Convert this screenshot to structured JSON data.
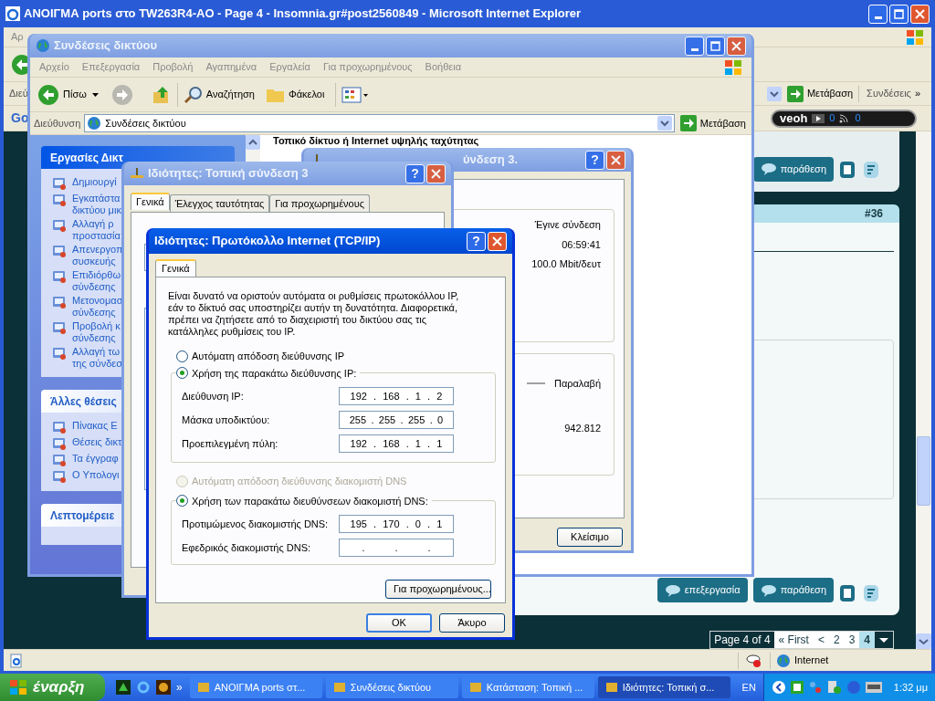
{
  "browser": {
    "title": "ΑΝΟΙΓΜΑ ports στο TW263R4-AO - Page 4 - Insomnia.gr#post2560849 - Microsoft Internet Explorer",
    "controls": [
      {
        "kind": "minimize"
      },
      {
        "kind": "maximize"
      },
      {
        "kind": "close"
      }
    ],
    "menu_fragment": "Αρ",
    "links_fragment": "Διεύ",
    "go_button": "Μετάβαση",
    "links_label": "Συνδέσεις",
    "links_chevron": "»",
    "google_fragment": "Go",
    "veoh_logo": "veoh",
    "veoh_counts": [
      "0",
      "0"
    ],
    "zone": "Internet"
  },
  "forum": {
    "quote_button_top": "παράθεση",
    "post_number": "#36",
    "edit_button": "επεξεργασία",
    "quote_button": "παράθεση",
    "page_label": "Page 4 of 4",
    "pages": [
      {
        "text": "« First",
        "selected": false
      },
      {
        "text": "<",
        "selected": false
      },
      {
        "text": "2",
        "selected": false
      },
      {
        "text": "3",
        "selected": false
      },
      {
        "text": "4",
        "selected": true
      }
    ]
  },
  "network_window": {
    "title": "Συνδέσεις δικτύου",
    "controls": [
      {
        "kind": "minimize"
      },
      {
        "kind": "maximize"
      },
      {
        "kind": "close"
      }
    ],
    "menu": [
      "Αρχείο",
      "Επεξεργασία",
      "Προβολή",
      "Αγαπημένα",
      "Εργαλεία",
      "Για προχωρημένους",
      "Βοήθεια"
    ],
    "back_button": "Πίσω",
    "search_button": "Αναζήτηση",
    "folders_button": "Φάκελοι",
    "address_label": "Διεύθυνση",
    "address": "Συνδέσεις δικτύου",
    "go_button": "Μετάβαση",
    "section_header": "Τοπικό δίκτυο ή Internet υψηλής ταχύτητας",
    "task_groups": [
      {
        "title": "Εργασίες Δικτ",
        "items": [
          [
            "Δημιουργί"
          ],
          [
            "Εγκατάστα",
            "δικτύου μικ"
          ],
          [
            "Αλλαγή ρ",
            "προστασία"
          ],
          [
            "Απενεργοπ",
            "συσκευής"
          ],
          [
            "Επιδιόρθω",
            "σύνδεσης"
          ],
          [
            "Μετονομασ",
            "σύνδεσης"
          ],
          [
            "Προβολή κ",
            "σύνδεσης"
          ],
          [
            "Αλλαγή τω",
            "της σύνδεσ"
          ]
        ]
      },
      {
        "title": "Άλλες θέσεις",
        "items": [
          [
            "Πίνακας Ε"
          ],
          [
            "Θέσεις δικτ"
          ],
          [
            "Τα έγγραφ"
          ],
          [
            "Ο Υπολογι"
          ]
        ]
      },
      {
        "title": "Λεπτομέρειε"
      }
    ]
  },
  "status_window": {
    "title": "ύνδεση 3.",
    "controls": [
      {
        "kind": "help",
        "text": "?"
      },
      {
        "kind": "close"
      }
    ],
    "status": "Έγινε σύνδεση",
    "duration": "06:59:41",
    "speed": "100.0 Mbit/δευτ",
    "legend": "Παραλαβή",
    "received": "942.812",
    "close_button": "Κλείσιμο"
  },
  "properties_window": {
    "title": "Ιδιότητες: Τοπική σύνδεση 3",
    "controls": [
      {
        "kind": "help",
        "text": "?"
      },
      {
        "kind": "close"
      }
    ],
    "tabs": [
      {
        "label": "Γενικά",
        "selected": true
      },
      {
        "label": "Έλεγχος ταυτότητας",
        "selected": false
      },
      {
        "label": "Για προχωρημένους",
        "selected": false
      }
    ]
  },
  "tcp_dialog": {
    "title": "Ιδιότητες: Πρωτόκολλο Internet (TCP/IP)",
    "controls": [
      {
        "kind": "help",
        "text": "?"
      },
      {
        "kind": "close"
      }
    ],
    "tabs": [
      {
        "label": "Γενικά",
        "selected": true
      }
    ],
    "intro": "Είναι δυνατό να οριστούν αυτόματα οι ρυθμίσεις πρωτοκόλλου IP, εάν το δίκτυό σας υποστηρίζει αυτήν τη δυνατότητα. Διαφορετικά, πρέπει να ζητήσετε από το διαχειριστή του δικτύου σας τις κατάλληλες ρυθμίσεις του IP.",
    "ip_mode": [
      {
        "label": "Αυτόματη απόδοση διεύθυνσης IP",
        "selected": false,
        "disabled": false
      },
      {
        "label": "Χρήση της παρακάτω διεύθυνσης IP:",
        "selected": true,
        "disabled": false
      }
    ],
    "ip_fields": [
      {
        "label": "Διεύθυνση IP:",
        "segments": [
          "192",
          ".",
          "168",
          ".",
          "1",
          ".",
          "2"
        ]
      },
      {
        "label": "Μάσκα υποδικτύου:",
        "segments": [
          "255",
          ".",
          "255",
          ".",
          "255",
          ".",
          "0"
        ]
      },
      {
        "label": "Προεπιλεγμένη πύλη:",
        "segments": [
          "192",
          ".",
          "168",
          ".",
          "1",
          ".",
          "1"
        ]
      }
    ],
    "dns_mode": [
      {
        "label": "Αυτόματη απόδοση διεύθυνσης διακομιστή DNS",
        "selected": false,
        "disabled": true
      },
      {
        "label": "Χρήση των παρακάτω διευθύνσεων διακομιστή DNS:",
        "selected": true,
        "disabled": false
      }
    ],
    "dns_fields": [
      {
        "label": "Προτιμώμενος διακομιστής DNS:",
        "segments": [
          "195",
          ".",
          "170",
          ".",
          "0",
          ".",
          "1"
        ]
      },
      {
        "label": "Εφεδρικός διακομιστής DNS:",
        "segments": [
          ".",
          ".",
          "."
        ]
      }
    ],
    "advanced_button": "Για προχωρημένους...",
    "ok_button": "OK",
    "cancel_button": "Άκυρο"
  },
  "taskbar": {
    "start": "έναρξη",
    "chevron": "»",
    "tasks": [
      {
        "label": "ΑΝΟΙΓΜΑ ports στ...",
        "selected": false
      },
      {
        "label": "Συνδέσεις δικτύου",
        "selected": false
      },
      {
        "label": "Κατάσταση: Τοπική ...",
        "selected": false
      },
      {
        "label": "Ιδιότητες: Τοπική σ...",
        "selected": true
      }
    ],
    "language": "EN",
    "clock": "1:32 μμ"
  }
}
